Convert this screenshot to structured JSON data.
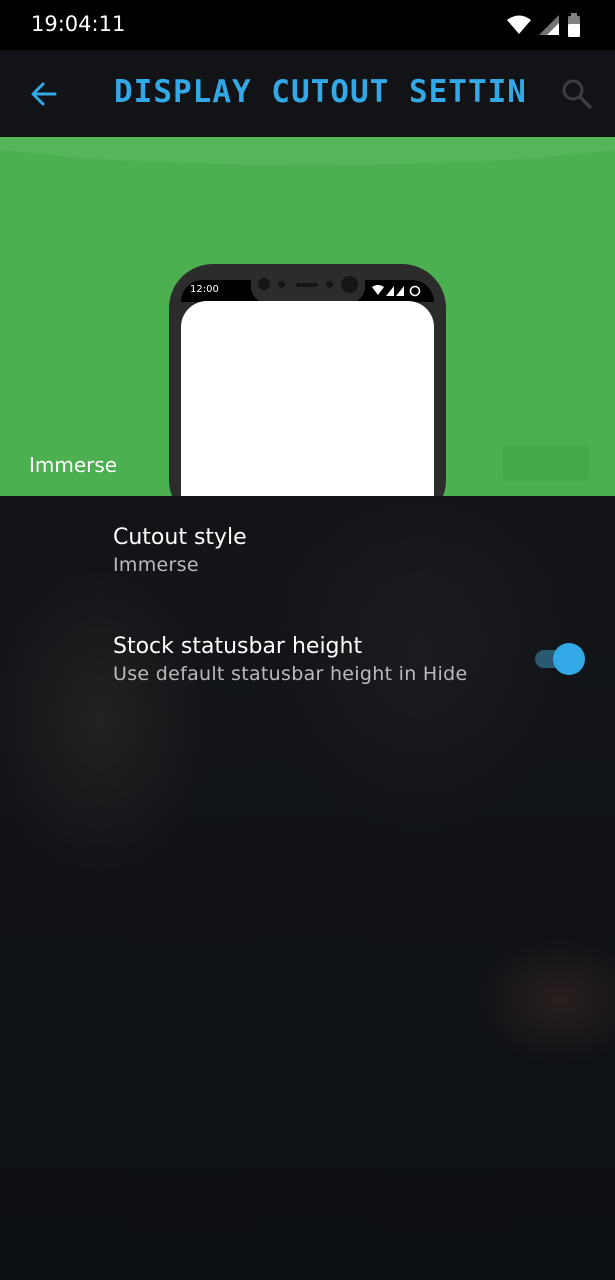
{
  "status_bar": {
    "time": "19:04:11",
    "icons": [
      "wifi-icon",
      "signal-icon",
      "battery-icon"
    ]
  },
  "app_bar": {
    "title": "DISPLAY CUTOUT SETTIN…",
    "back_icon": "arrow-left-icon",
    "search_icon": "search-icon"
  },
  "preview": {
    "label": "Immerse",
    "phone_time": "12:00"
  },
  "settings": [
    {
      "title": "Cutout style",
      "summary": "Immerse"
    },
    {
      "title": "Stock statusbar height",
      "summary": "Use default statusbar height in Hide",
      "toggle_on": true
    }
  ],
  "colors": {
    "accent": "#32a9e6",
    "preview_bg": "#4caf50",
    "app_bar_bg": "#111316",
    "status_bar_bg": "#000000"
  }
}
